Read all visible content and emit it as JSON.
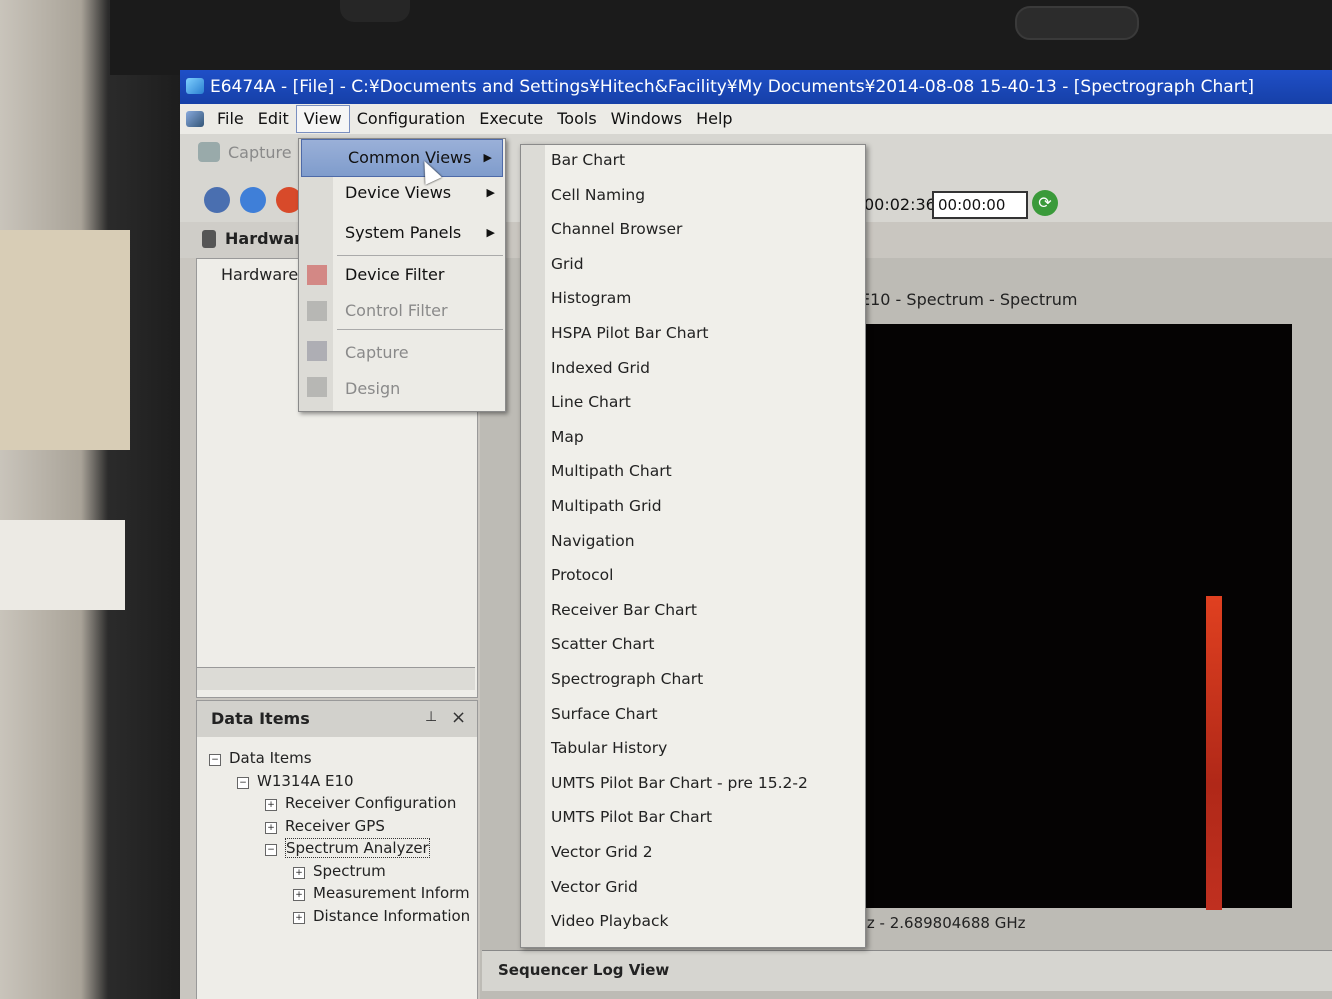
{
  "window": {
    "title": "E6474A - [File] - C:¥Documents and Settings¥Hitech&Facility¥My Documents¥2014-08-08 15-40-13 - [Spectrograph Chart]"
  },
  "menubar": {
    "items": [
      "File",
      "Edit",
      "View",
      "Configuration",
      "Execute",
      "Tools",
      "Windows",
      "Help"
    ],
    "active": "View"
  },
  "toolbar": {
    "capture_label": "Capture",
    "elapsed_time": "00:02:36",
    "time_field_value": "00:00:00"
  },
  "hardware_panel": {
    "title": "Hardware",
    "tree_root": "Hardware"
  },
  "view_menu": {
    "items": [
      {
        "label": "Common Views",
        "submenu": true,
        "highlighted": true,
        "enabled": true
      },
      {
        "label": "Device Views",
        "submenu": true,
        "highlighted": false,
        "enabled": true
      },
      {
        "label": "System Panels",
        "submenu": true,
        "highlighted": false,
        "enabled": true
      },
      {
        "label": "Device Filter",
        "submenu": false,
        "highlighted": false,
        "enabled": true
      },
      {
        "label": "Control Filter",
        "submenu": false,
        "highlighted": false,
        "enabled": false
      },
      {
        "label": "Capture",
        "submenu": false,
        "highlighted": false,
        "enabled": false
      },
      {
        "label": "Design",
        "submenu": false,
        "highlighted": false,
        "enabled": false
      }
    ]
  },
  "common_views_menu": {
    "items": [
      "Bar Chart",
      "Cell Naming",
      "Channel Browser",
      "Grid",
      "Histogram",
      "HSPA Pilot Bar Chart",
      "Indexed Grid",
      "Line Chart",
      "Map",
      "Multipath Chart",
      "Multipath Grid",
      "Navigation",
      "Protocol",
      "Receiver Bar Chart",
      "Scatter Chart",
      "Spectrograph Chart",
      "Surface Chart",
      "Tabular History",
      "UMTS Pilot Bar Chart - pre 15.2-2",
      "UMTS Pilot Bar Chart",
      "Vector Grid 2",
      "Vector Grid",
      "Video Playback"
    ]
  },
  "data_items_panel": {
    "title": "Data Items",
    "tree": [
      {
        "label": "Data Items",
        "level": 0,
        "expander": "minus"
      },
      {
        "label": "W1314A E10",
        "level": 1,
        "expander": "minus"
      },
      {
        "label": "Receiver Configuration",
        "level": 2,
        "expander": "plus"
      },
      {
        "label": "Receiver GPS",
        "level": 2,
        "expander": "plus"
      },
      {
        "label": "Spectrum Analyzer",
        "level": 2,
        "expander": "minus",
        "selected": true
      },
      {
        "label": "Spectrum",
        "level": 3,
        "expander": "plus"
      },
      {
        "label": "Measurement Inform",
        "level": 3,
        "expander": "plus"
      },
      {
        "label": "Distance Information",
        "level": 3,
        "expander": "plus"
      }
    ]
  },
  "chart_view": {
    "title": "E10 - Spectrum - Spectrum",
    "freq_range_label": "GHz - 2.689804688 GHz"
  },
  "sequencer": {
    "title": "Sequencer Log View"
  },
  "colors": {
    "title_bar": "#1f4fc7",
    "menu_highlight": "#8aa4d2",
    "chart_background": "#050303",
    "spectrum_trace": "#d03820",
    "refresh_button": "#3a9a3a"
  }
}
